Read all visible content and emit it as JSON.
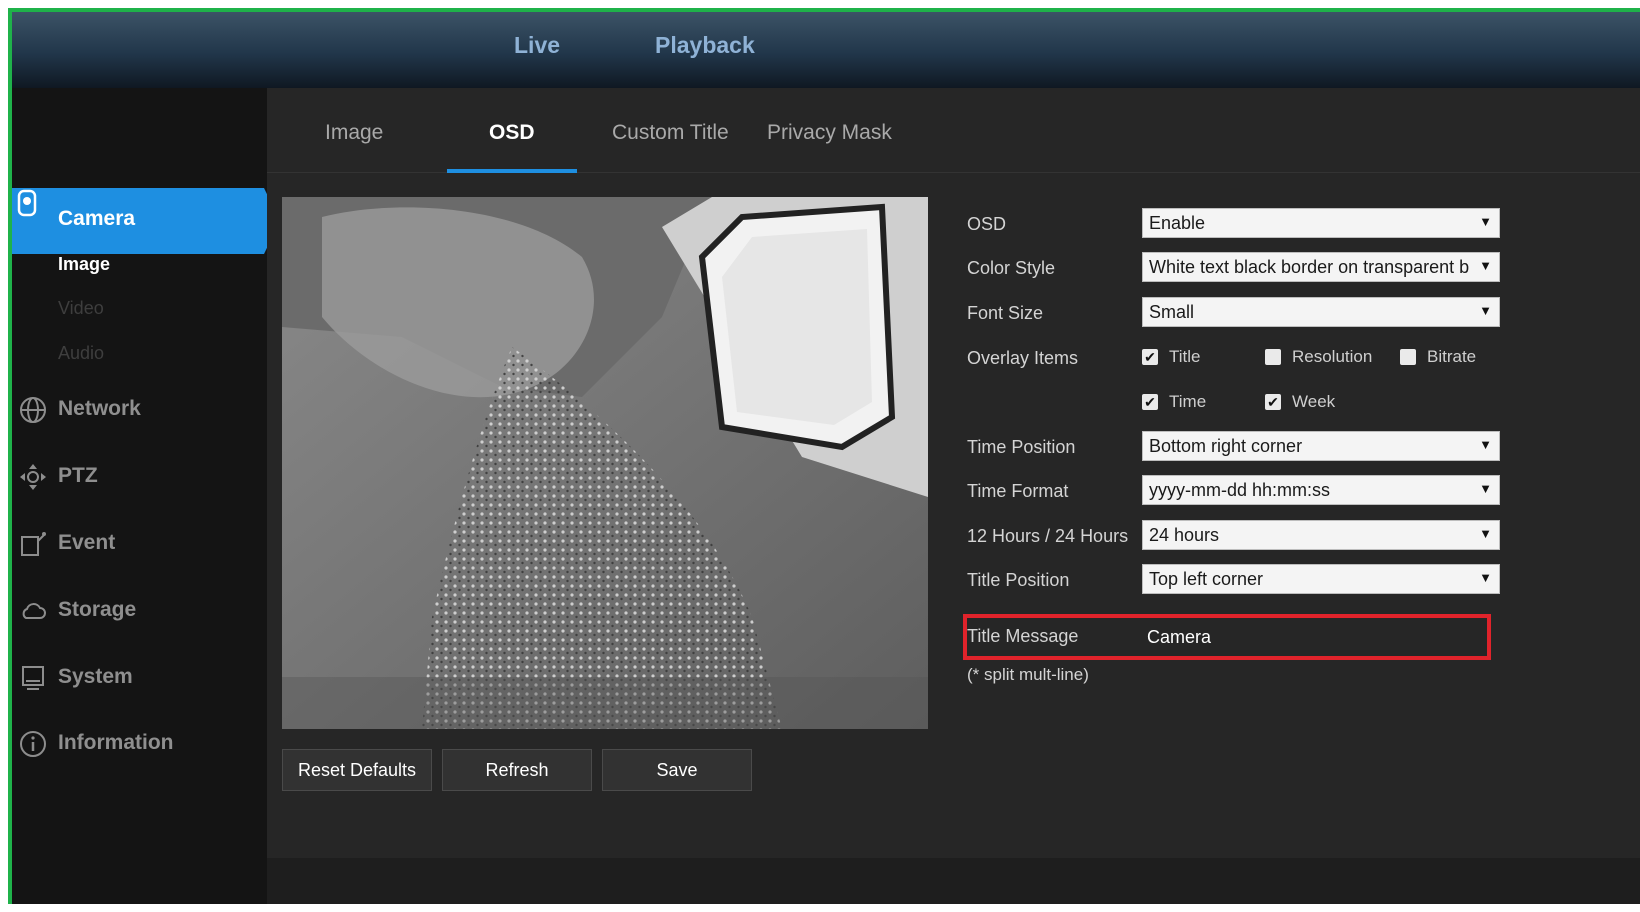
{
  "topbar": {
    "live": "Live",
    "playback": "Playback"
  },
  "sidebar": {
    "items": [
      {
        "label": "Camera",
        "icon": "camera-icon",
        "active": true
      },
      {
        "label": "Network",
        "icon": "globe-icon"
      },
      {
        "label": "PTZ",
        "icon": "ptz-icon"
      },
      {
        "label": "Event",
        "icon": "event-icon"
      },
      {
        "label": "Storage",
        "icon": "cloud-icon"
      },
      {
        "label": "System",
        "icon": "monitor-icon"
      },
      {
        "label": "Information",
        "icon": "info-icon"
      }
    ],
    "subitems": [
      "Image",
      "Video",
      "Audio"
    ],
    "accent": "#1e8fe1"
  },
  "tabs": [
    "Image",
    "OSD",
    "Custom Title",
    "Privacy Mask"
  ],
  "active_tab": "OSD",
  "buttons": {
    "reset": "Reset Defaults",
    "refresh": "Refresh",
    "save": "Save"
  },
  "form": {
    "osd": {
      "label": "OSD",
      "value": "Enable"
    },
    "color_style": {
      "label": "Color Style",
      "value": "White text black border on transparent b"
    },
    "font_size": {
      "label": "Font Size",
      "value": "Small"
    },
    "overlay_items": {
      "label": "Overlay Items",
      "options": [
        {
          "label": "Title",
          "checked": true
        },
        {
          "label": "Resolution",
          "checked": false
        },
        {
          "label": "Bitrate",
          "checked": false
        },
        {
          "label": "Time",
          "checked": true
        },
        {
          "label": "Week",
          "checked": true
        }
      ]
    },
    "time_position": {
      "label": "Time Position",
      "value": "Bottom right corner"
    },
    "time_format": {
      "label": "Time Format",
      "value": "yyyy-mm-dd hh:mm:ss"
    },
    "hour_mode": {
      "label": "12 Hours / 24 Hours",
      "value": "24 hours"
    },
    "title_position": {
      "label": "Title Position",
      "value": "Top left corner"
    },
    "title_message": {
      "label": "Title Message",
      "value": "Camera"
    },
    "split_note": "(* split mult-line)"
  },
  "highlight_color": "#e0232b"
}
